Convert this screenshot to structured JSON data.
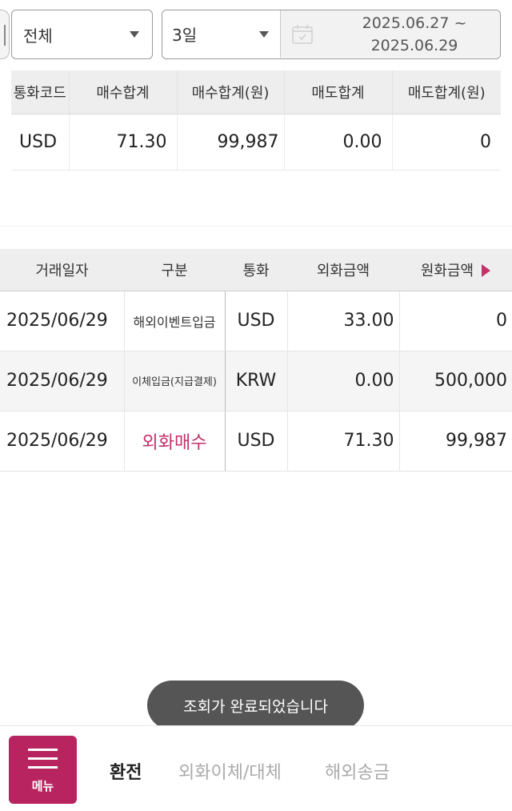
{
  "filters": {
    "category": "전체",
    "period": "3일",
    "date_from": "2025.06.27 ~",
    "date_to": "2025.06.29"
  },
  "summary": {
    "headers": [
      "통화코드",
      "매수합계",
      "매수합계(원)",
      "매도합계",
      "매도합계(원)"
    ],
    "row": {
      "currency": "USD",
      "buy_total": "71.30",
      "buy_total_krw": "99,987",
      "sell_total": "0.00",
      "sell_total_krw": "0"
    }
  },
  "transactions": {
    "headers": [
      "거래일자",
      "구분",
      "통화",
      "외화금액",
      "원화금액"
    ],
    "rows": [
      {
        "date": "2025/06/29",
        "type": "해외이벤트입금",
        "currency": "USD",
        "fx_amount": "33.00",
        "krw_amount": "0"
      },
      {
        "date": "2025/06/29",
        "type": "이체입금(지급결제)",
        "currency": "KRW",
        "fx_amount": "0.00",
        "krw_amount": "500,000"
      },
      {
        "date": "2025/06/29",
        "type": "외화매수",
        "currency": "USD",
        "fx_amount": "71.30",
        "krw_amount": "99,987"
      }
    ]
  },
  "toast": "조회가 완료되었습니다",
  "bottom_nav": {
    "menu_label": "메뉴",
    "tabs": [
      "환전",
      "외화이체/대체",
      "해외송금"
    ]
  },
  "colors": {
    "accent": "#c4306b",
    "menu_bg": "#b7245f"
  }
}
